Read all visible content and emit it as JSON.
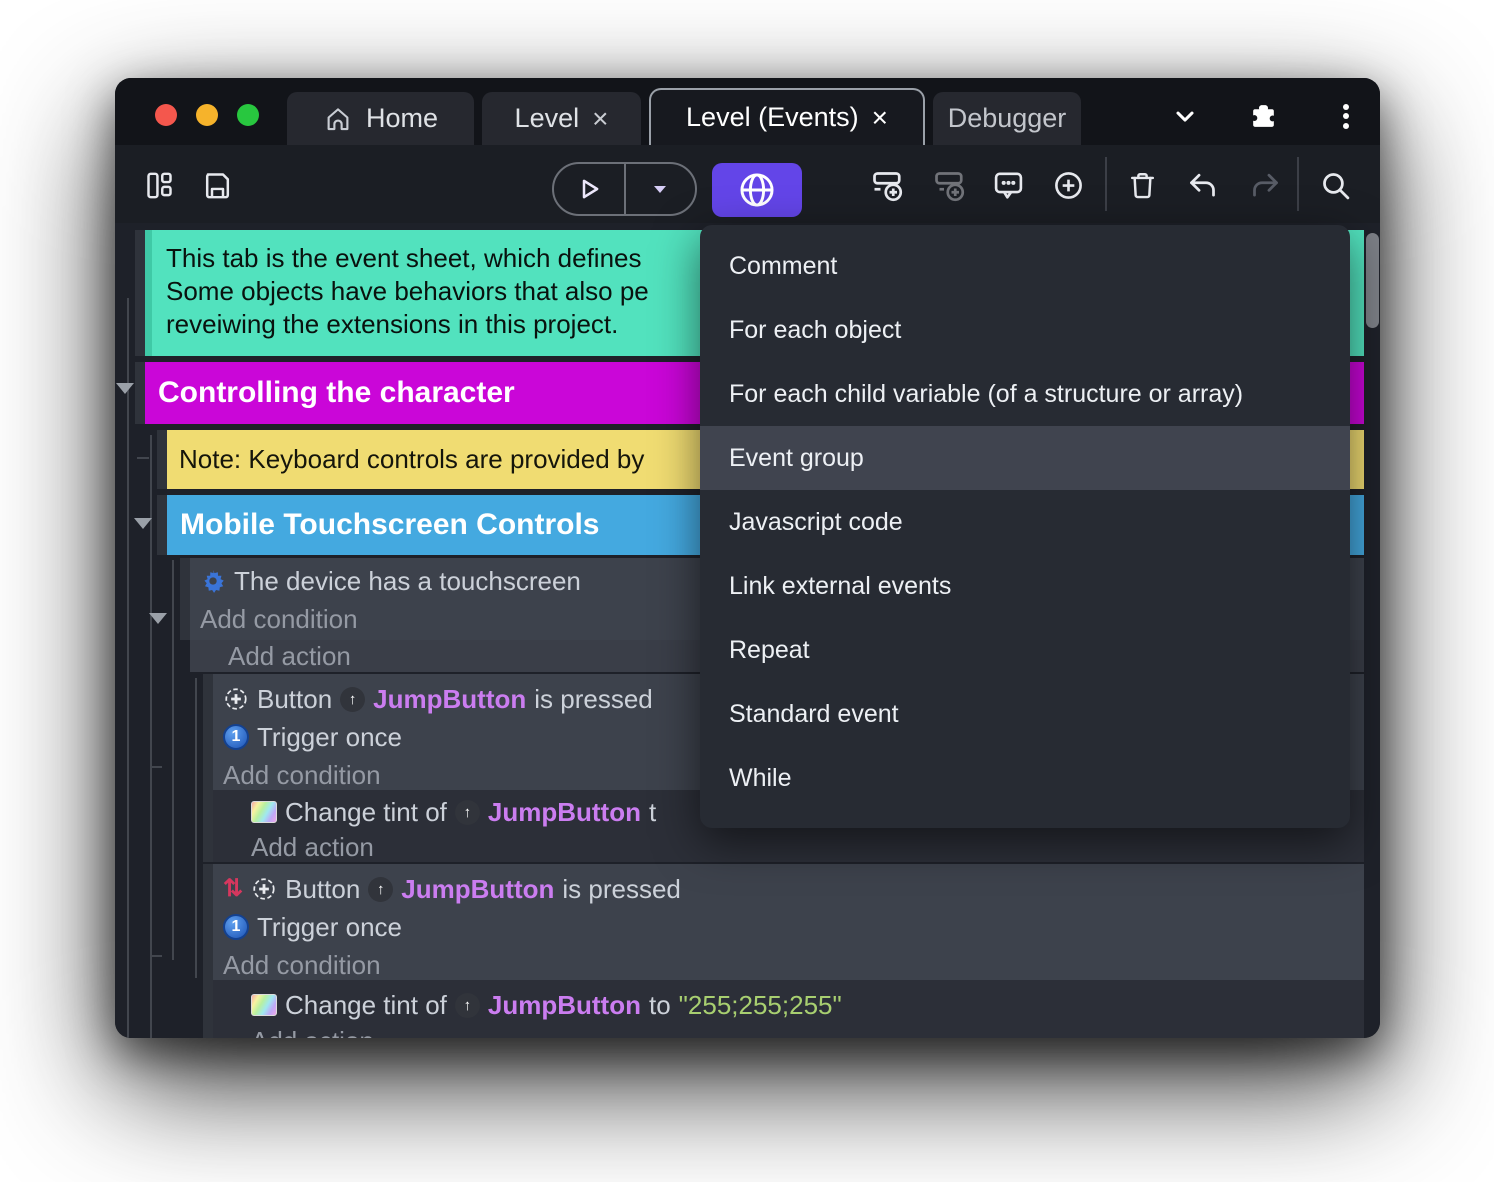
{
  "titlebar": {
    "tabs": [
      {
        "label": "Home"
      },
      {
        "label": "Level"
      },
      {
        "label": "Level (Events)"
      },
      {
        "label": "Debugger"
      }
    ],
    "close_glyph": "×"
  },
  "colors": {
    "accent_purple": "#6345e8",
    "comment_green": "#52e2be",
    "group_magenta": "#ca06d8",
    "note_yellow": "#f0dc72",
    "group_blue": "#44a9e0",
    "object_name": "#cb7df0",
    "string_value": "#a8cf70",
    "traffic_red": "#f4574d",
    "traffic_yellow": "#f6b32b",
    "traffic_green": "#28c73f"
  },
  "sheet": {
    "comment_line1": "This tab is the event sheet, which defines",
    "comment_line2": "Some objects have behaviors that also pe",
    "comment_line3": "reveiwing the extensions in this project.",
    "group_character": "Controlling the character",
    "note": "Note: Keyboard controls are provided by",
    "group_touchscreen": "Mobile Touchscreen Controls",
    "cond_touchscreen": "The device has a touchscreen",
    "add_condition": "Add condition",
    "add_action": "Add action",
    "btn_prefix": "Button",
    "btn_object": "JumpButton",
    "btn_suffix": "is pressed",
    "trigger_once": "Trigger once",
    "tint_prefix": "Change tint of",
    "tint_object": "JumpButton",
    "tint_tail": "t",
    "tint_to": "to",
    "tint_value": "\"255;255;255\"",
    "once_digit": "1",
    "invert_glyph": "⇅"
  },
  "context_menu": {
    "items": [
      "Comment",
      "For each object",
      "For each child variable (of a structure or array)",
      "Event group",
      "Javascript code",
      "Link external events",
      "Repeat",
      "Standard event",
      "While"
    ],
    "highlighted": "Event group"
  }
}
